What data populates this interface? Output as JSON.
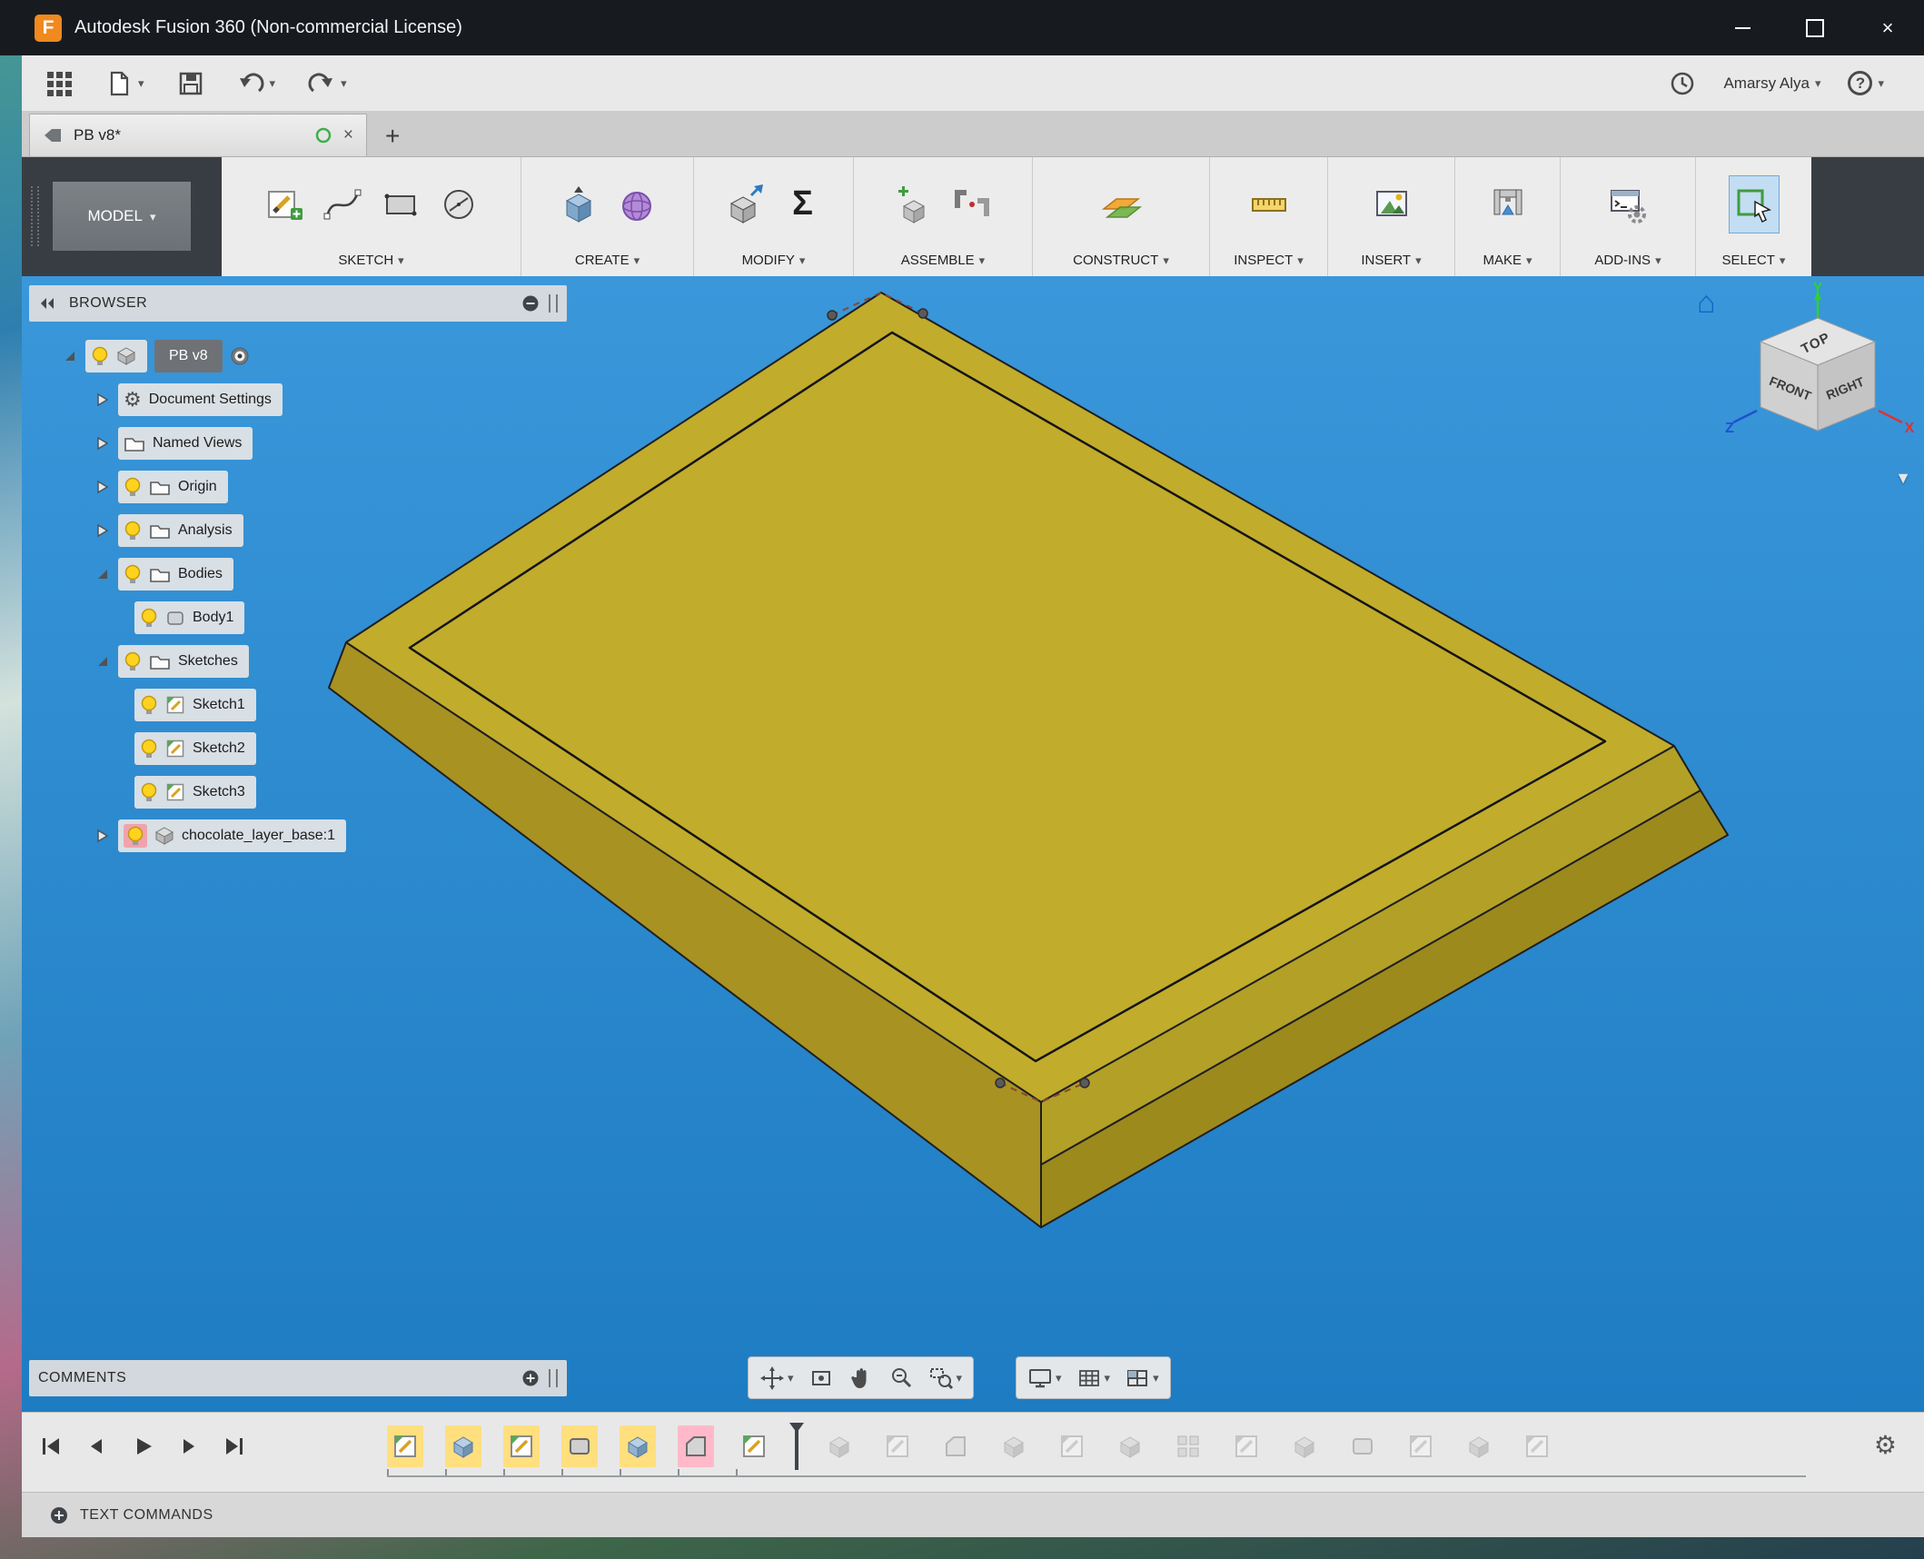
{
  "window": {
    "title": "Autodesk Fusion 360 (Non-commercial License)"
  },
  "qat": {
    "user_name": "Amarsy Alya"
  },
  "tabbar": {
    "active_tab": "PB v8*"
  },
  "ribbon": {
    "workspace": "MODEL",
    "groups": [
      {
        "label": "SKETCH"
      },
      {
        "label": "CREATE"
      },
      {
        "label": "MODIFY"
      },
      {
        "label": "ASSEMBLE"
      },
      {
        "label": "CONSTRUCT"
      },
      {
        "label": "INSPECT"
      },
      {
        "label": "INSERT"
      },
      {
        "label": "MAKE"
      },
      {
        "label": "ADD-INS"
      },
      {
        "label": "SELECT"
      }
    ]
  },
  "browser": {
    "title": "BROWSER",
    "tree": [
      {
        "label": "PB v8"
      },
      {
        "label": "Document Settings"
      },
      {
        "label": "Named Views"
      },
      {
        "label": "Origin"
      },
      {
        "label": "Analysis"
      },
      {
        "label": "Bodies"
      },
      {
        "label": "Body1"
      },
      {
        "label": "Sketches"
      },
      {
        "label": "Sketch1"
      },
      {
        "label": "Sketch2"
      },
      {
        "label": "Sketch3"
      },
      {
        "label": "chocolate_layer_base:1"
      }
    ]
  },
  "viewcube": {
    "top": "TOP",
    "front": "FRONT",
    "right": "RIGHT",
    "axis_x": "X",
    "axis_y": "Y",
    "axis_z": "Z"
  },
  "comments": {
    "title": "COMMENTS"
  },
  "statusbar": {
    "text_commands": "TEXT COMMANDS"
  },
  "timeline": {
    "features": [
      {
        "type": "sketch",
        "state": "yellow"
      },
      {
        "type": "extrude",
        "state": "yellow"
      },
      {
        "type": "sketch",
        "state": "yellow"
      },
      {
        "type": "box",
        "state": "yellow"
      },
      {
        "type": "extrude",
        "state": "yellow"
      },
      {
        "type": "chamfer",
        "state": "pink"
      },
      {
        "type": "sketch",
        "state": "normal"
      },
      {
        "type": "marker"
      },
      {
        "type": "extrude",
        "state": "future"
      },
      {
        "type": "sketch",
        "state": "future"
      },
      {
        "type": "chamfer",
        "state": "future"
      },
      {
        "type": "extrude",
        "state": "future"
      },
      {
        "type": "sketch",
        "state": "future"
      },
      {
        "type": "extrude",
        "state": "future"
      },
      {
        "type": "pattern",
        "state": "future"
      },
      {
        "type": "sketch",
        "state": "future"
      },
      {
        "type": "extrude",
        "state": "future"
      },
      {
        "type": "box",
        "state": "future"
      },
      {
        "type": "sketch",
        "state": "future"
      },
      {
        "type": "extrude",
        "state": "future"
      },
      {
        "type": "sketch",
        "state": "future"
      }
    ]
  },
  "icons": {
    "caret": "▾",
    "viewcube_caret": "▼",
    "close": "×",
    "plus": "+",
    "question_mark": "?",
    "gear": "⚙",
    "home": "⌂",
    "sigma": "Σ"
  },
  "colors": {
    "canvas_top": "#3a97da",
    "canvas_bottom": "#1e7cc3",
    "model_top": "#c1ac2c",
    "model_left": "#a89222",
    "model_right_upper": "#b3a026",
    "model_right_lower": "#9c8a1d",
    "select_highlight": "#c3ddf2",
    "timeline_yellow": "#ffdf7e",
    "timeline_pink": "#ffb9c8"
  }
}
